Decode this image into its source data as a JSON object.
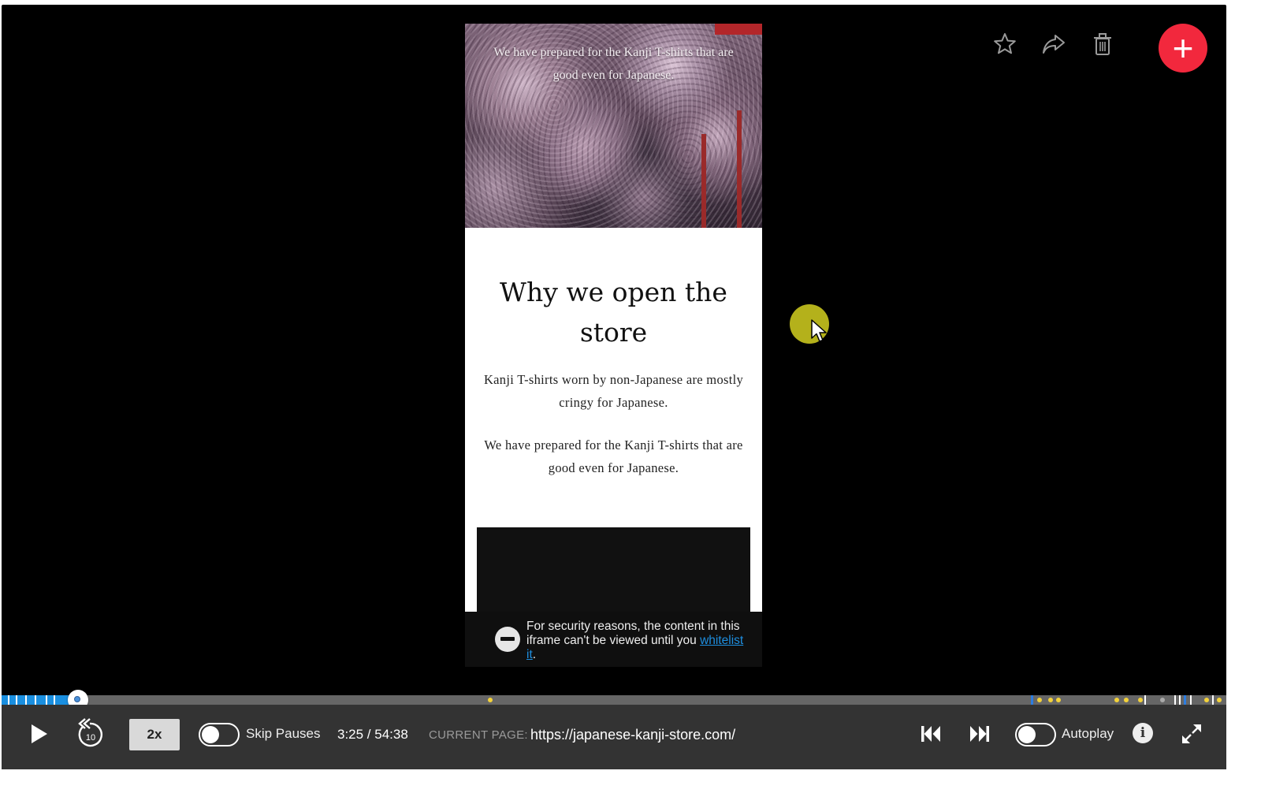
{
  "viewport": {
    "hero_text": "We have prepared for the Kanji T-shirts that are good even for Japanese.",
    "heading": "Why we open the store",
    "paragraph_1": "Kanji T-shirts worn by non-Japanese are mostly cringy for Japanese.",
    "paragraph_2": "We have prepared for the Kanji T-shirts that are good even for Japanese.",
    "security_notice_prefix": "For security reasons, the content in this iframe can't be viewed until you ",
    "security_link": "whitelist it",
    "security_suffix": "."
  },
  "actions": {
    "star_icon": "star-icon",
    "share_icon": "share-icon",
    "trash_icon": "trash-icon",
    "add_label": "+"
  },
  "controls": {
    "rewind_seconds": "10",
    "speed": "2x",
    "skip_pauses_label": "Skip Pauses",
    "time": "3:25 / 54:38",
    "current_page_label": "CURRENT PAGE:",
    "current_page_url": "https://japanese-kanji-store.com/",
    "autoplay_label": "Autoplay",
    "info_label": "i",
    "skip_pauses_on": false,
    "autoplay_on": false
  },
  "timeline": {
    "progress_fraction": 0.0625
  },
  "colors": {
    "accent_red": "#f2283d",
    "timeline_blue": "#1a8fe0",
    "cursor_halo": "#c8c41e",
    "event_dot": "#f3d23a"
  }
}
